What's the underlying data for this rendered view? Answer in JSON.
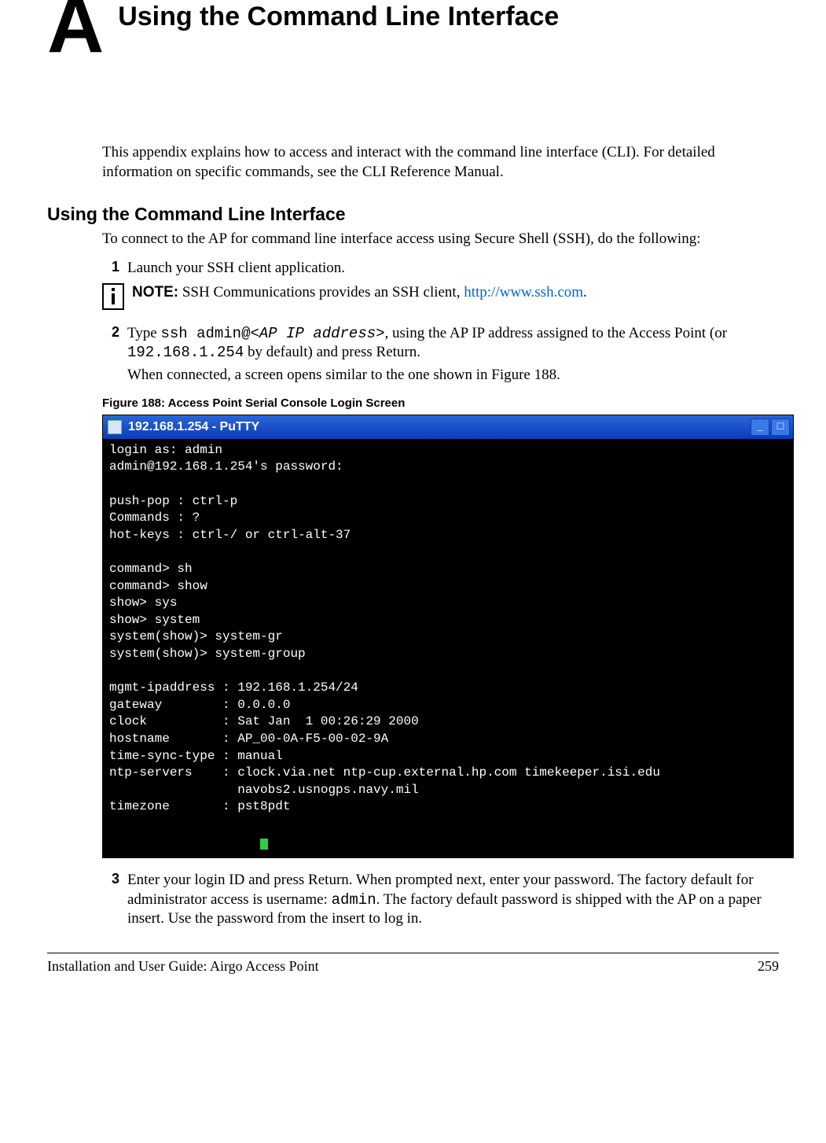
{
  "appendix": {
    "letter": "A",
    "title": "Using the Command Line Interface"
  },
  "intro": "This appendix explains how to access and interact with the command line interface (CLI). For detailed information on specific commands, see the CLI Reference Manual.",
  "section": {
    "heading": "Using the Command Line Interface",
    "intro": "To connect to the AP for command line interface access using Secure Shell (SSH), do the following:"
  },
  "steps": {
    "s1": {
      "num": "1",
      "text": "Launch your SSH client application."
    },
    "note": {
      "label": "NOTE:",
      "text_before": " SSH Communications provides an SSH client, ",
      "link": "http://www.ssh.com",
      "text_after": "."
    },
    "s2": {
      "num": "2",
      "prefix": "Type ",
      "cmd": "ssh admin@",
      "arg": "<AP IP address>",
      "mid": ", using the AP IP address assigned to the Access Point (or ",
      "ip": "192.168.1.254",
      "suffix": " by default) and press Return.",
      "line2": "When connected, a screen opens similar to the one shown in Figure 188."
    },
    "s3": {
      "num": "3",
      "prefix": "Enter your login ID and press Return. When prompted next, enter your password. The factory default for administrator access is username: ",
      "user": "admin",
      "suffix": ". The factory default password is shipped with the AP on a paper insert. Use the password from the insert to log in."
    }
  },
  "figure": {
    "caption": "Figure 188:    Access Point Serial Console Login Screen"
  },
  "terminal": {
    "title": "192.168.1.254 - PuTTY",
    "lines": [
      "login as: admin",
      "admin@192.168.1.254's password:",
      "",
      "push-pop : ctrl-p",
      "Commands : ?",
      "hot-keys : ctrl-/ or ctrl-alt-37",
      "",
      "command> sh",
      "command> show",
      "show> sys",
      "show> system",
      "system(show)> system-gr",
      "system(show)> system-group",
      "",
      "mgmt-ipaddress : 192.168.1.254/24",
      "gateway        : 0.0.0.0",
      "clock          : Sat Jan  1 00:26:29 2000",
      "hostname       : AP_00-0A-F5-00-02-9A",
      "time-sync-type : manual",
      "ntp-servers    : clock.via.net ntp-cup.external.hp.com timekeeper.isi.edu",
      "                 navobs2.usnogps.navy.mil",
      "timezone       : pst8pdt",
      ""
    ]
  },
  "footer": {
    "left": "Installation and User Guide: Airgo Access Point",
    "right": "259"
  }
}
